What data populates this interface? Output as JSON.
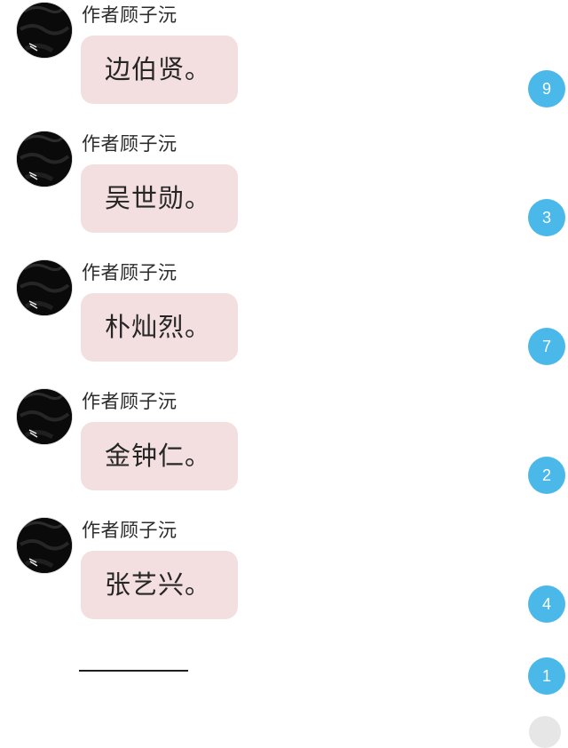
{
  "messages": [
    {
      "author": "作者顾子沅",
      "text": "边伯贤。",
      "badge": "9"
    },
    {
      "author": "作者顾子沅",
      "text": "吴世勋。",
      "badge": "3"
    },
    {
      "author": "作者顾子沅",
      "text": "朴灿烈。",
      "badge": "7"
    },
    {
      "author": "作者顾子沅",
      "text": "金钟仁。",
      "badge": "2"
    },
    {
      "author": "作者顾子沅",
      "text": "张艺兴。",
      "badge": "4"
    }
  ],
  "footer": {
    "badge": "1"
  },
  "colors": {
    "bubble": "#f3dfdf",
    "badge": "#4ab8e8",
    "author_text": "#2c2c2c"
  },
  "icons": {
    "avatar": "avatar-image"
  }
}
